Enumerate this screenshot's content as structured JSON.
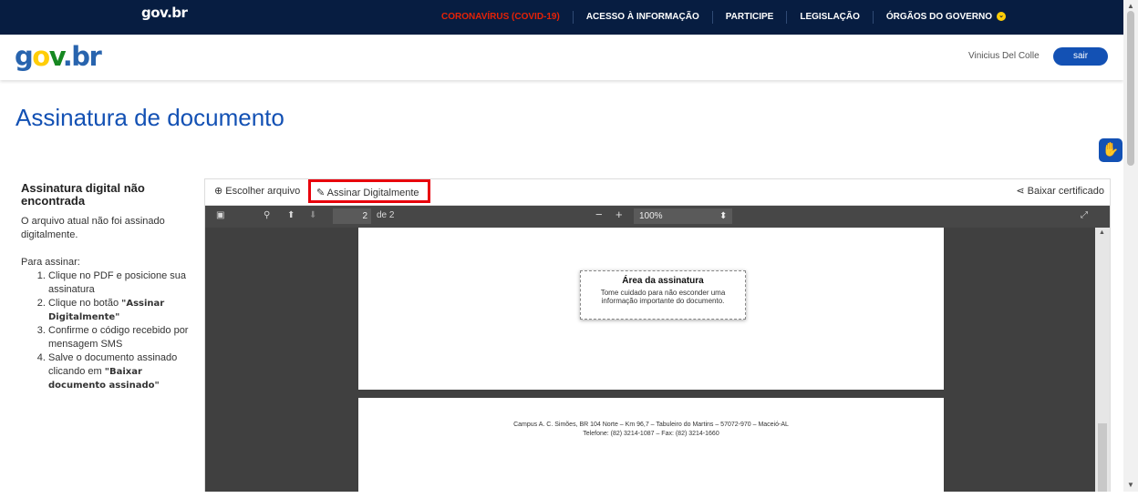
{
  "topbar": {
    "brand": "gov.br",
    "links": [
      "CORONAVÍRUS (COVID-19)",
      "ACESSO À INFORMAÇÃO",
      "PARTICIPE",
      "LEGISLAÇÃO",
      "ÓRGÃOS DO GOVERNO"
    ],
    "chevron": "⌄"
  },
  "header": {
    "logo_g": "g",
    "logo_o": "o",
    "logo_v": "v",
    "logo_dot": ".",
    "logo_b": "b",
    "logo_r": "r",
    "user_name": "Vinicius Del Colle",
    "logout_label": "sair"
  },
  "page_title": "Assinatura de documento",
  "sidebar": {
    "heading": "Assinatura digital não encontrada",
    "status": "O arquivo atual não foi assinado digitalmente.",
    "intro": "Para assinar:",
    "step1": "Clique no PDF e posicione sua assinatura",
    "step2_pre": "Clique no botão ",
    "step2_bold": "\"Assinar Digitalmente\"",
    "step3": "Confirme o código recebido por mensagem SMS",
    "step4_pre": "Salve o documento assinado clicando em ",
    "step4_bold": "\"Baixar documento assinado\""
  },
  "toolbar": {
    "choose_label": "Escolher arquivo",
    "sign_label": "Assinar Digitalmente",
    "download_label": "Baixar certificado"
  },
  "pdf": {
    "page_current": "2",
    "page_total": "de 2",
    "zoom": "100%",
    "sig_title": "Área da assinatura",
    "sig_line1": "Tome cuidado para não esconder uma",
    "sig_line2": "informação importante do documento.",
    "footer_line1": "Campus A. C. Simões, BR 104 Norte – Km 96,7 – Tabuleiro do Martins – 57072-970 – Maceió-AL",
    "footer_line2": "Telefone: (82) 3214-1087 – Fax: (82) 3214-1660"
  },
  "colors": {
    "topbar": "#071D41",
    "primary": "#1351B4",
    "highlight": "#e8000b",
    "covid": "#e52207"
  },
  "icons": [
    "sidebar-toggle-icon",
    "search-icon",
    "arrow-up-icon",
    "arrow-down-icon",
    "minus-icon",
    "plus-icon",
    "fullscreen-icon",
    "plus-circle-icon",
    "edit-icon",
    "share-icon",
    "vlibras-icon"
  ]
}
